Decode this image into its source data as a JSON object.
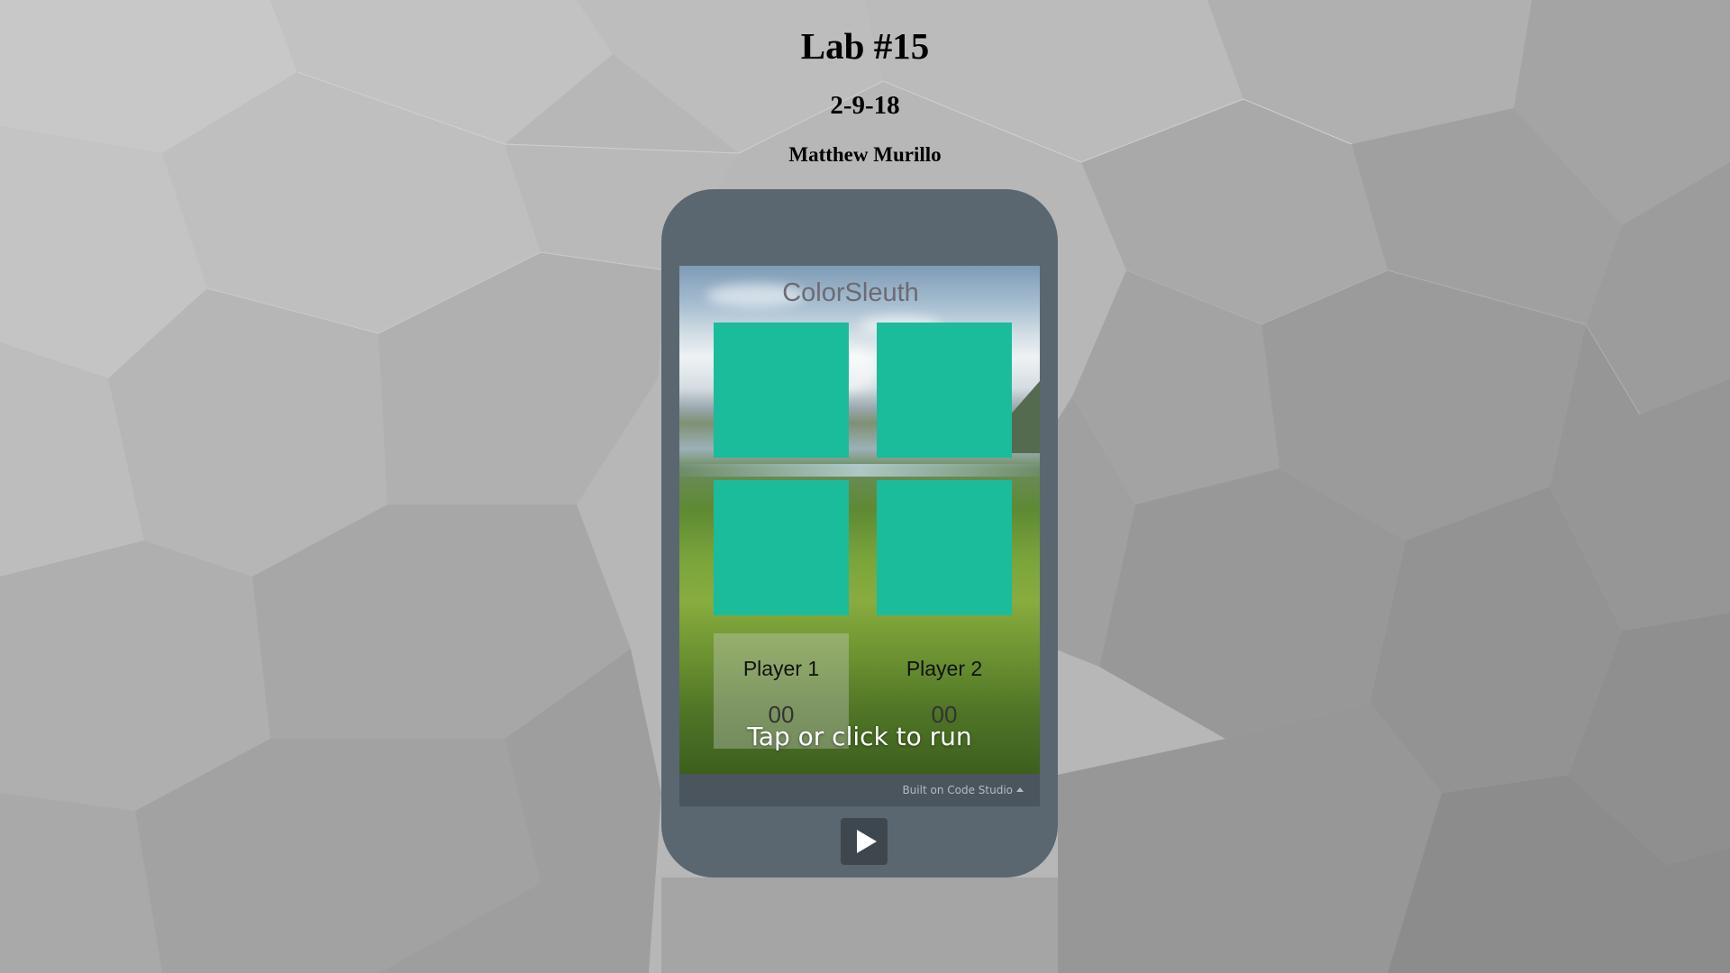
{
  "page": {
    "title": "Lab #15",
    "date": "2-9-18",
    "author": "Matthew Murillo"
  },
  "app": {
    "name": "ColorSleuth",
    "tile_color": "#1abc9c",
    "player1": {
      "label": "Player 1",
      "score": "00"
    },
    "player2": {
      "label": "Player 2",
      "score": "00"
    },
    "overlay": "Tap or click to run"
  },
  "footer": {
    "built_on": "Built on Code Studio",
    "icon": "caret-up-icon"
  },
  "controls": {
    "play_icon": "play-icon"
  }
}
